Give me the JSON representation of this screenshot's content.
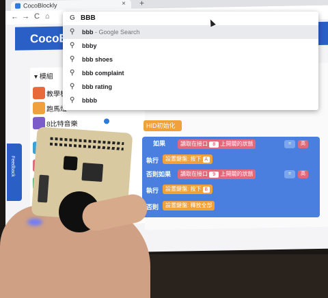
{
  "browser": {
    "tab_title": "CocoBlockly",
    "tab_close": "×",
    "new_tab": "+",
    "nav": {
      "back": "←",
      "forward": "→",
      "reload": "C",
      "home": "⌂"
    }
  },
  "omnibox": {
    "engine_glyph": "G",
    "input_value": "BBB",
    "suggestions": [
      {
        "text": "bbb",
        "hint": " - Google Search"
      },
      {
        "text": "bbby",
        "hint": ""
      },
      {
        "text": "bbb shoes",
        "hint": ""
      },
      {
        "text": "bbb complaint",
        "hint": ""
      },
      {
        "text": "bbb rating",
        "hint": ""
      },
      {
        "text": "bbbb",
        "hint": ""
      }
    ]
  },
  "app": {
    "logo": "CocoBl",
    "feedback_label": "Feedback"
  },
  "palette": {
    "header": "▾ 模組",
    "items": [
      "教學板",
      "跑馬燈",
      "8比特音樂"
    ]
  },
  "blocks": {
    "hid_init": "HID初始化",
    "if_kw": "如果",
    "do_kw": "執行",
    "elseif_kw": "否則如果",
    "else_kw": "否則",
    "read_port": "讀取在接口",
    "switch_state": "上開關的狀態",
    "pin1": "8",
    "pin2": "9",
    "eq": "=",
    "high": "高",
    "set_key_press": "設置鍵盤: 按下",
    "key_a": "A",
    "key_b": "B",
    "release_all": "設置鍵盤: 釋放全部"
  },
  "colors": {
    "app_bar": "#2a5fc5",
    "logic_block": "#4a7fe0",
    "sensor_block": "#e06a7a",
    "keyboard_block": "#f0a13c"
  }
}
